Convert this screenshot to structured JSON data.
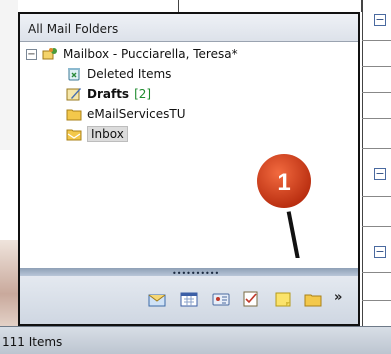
{
  "header": {
    "title": "All Mail Folders"
  },
  "folders": [
    {
      "label": "Mailbox - Pucciarella, Teresa*",
      "icon": "mailbox-icon"
    },
    {
      "label": "Deleted Items",
      "icon": "deleted-items-icon"
    },
    {
      "label": "Drafts",
      "count": "[2]",
      "icon": "drafts-icon"
    },
    {
      "label": "eMailServicesTU",
      "icon": "folder-icon"
    },
    {
      "label": "Inbox",
      "icon": "inbox-icon"
    }
  ],
  "expander_symbol": "⊟",
  "toolbar": {
    "buttons": [
      "mail-icon",
      "calendar-icon",
      "contacts-icon",
      "tasks-icon",
      "notes-icon",
      "folder-list-icon"
    ],
    "more": "»"
  },
  "callout": {
    "number": "1",
    "color": "#d9401c"
  },
  "status": {
    "text": "111 Items"
  },
  "colors": {
    "accent": "#d9401c",
    "count": "#1c8a2c",
    "splitter": "#8ea0b6"
  }
}
